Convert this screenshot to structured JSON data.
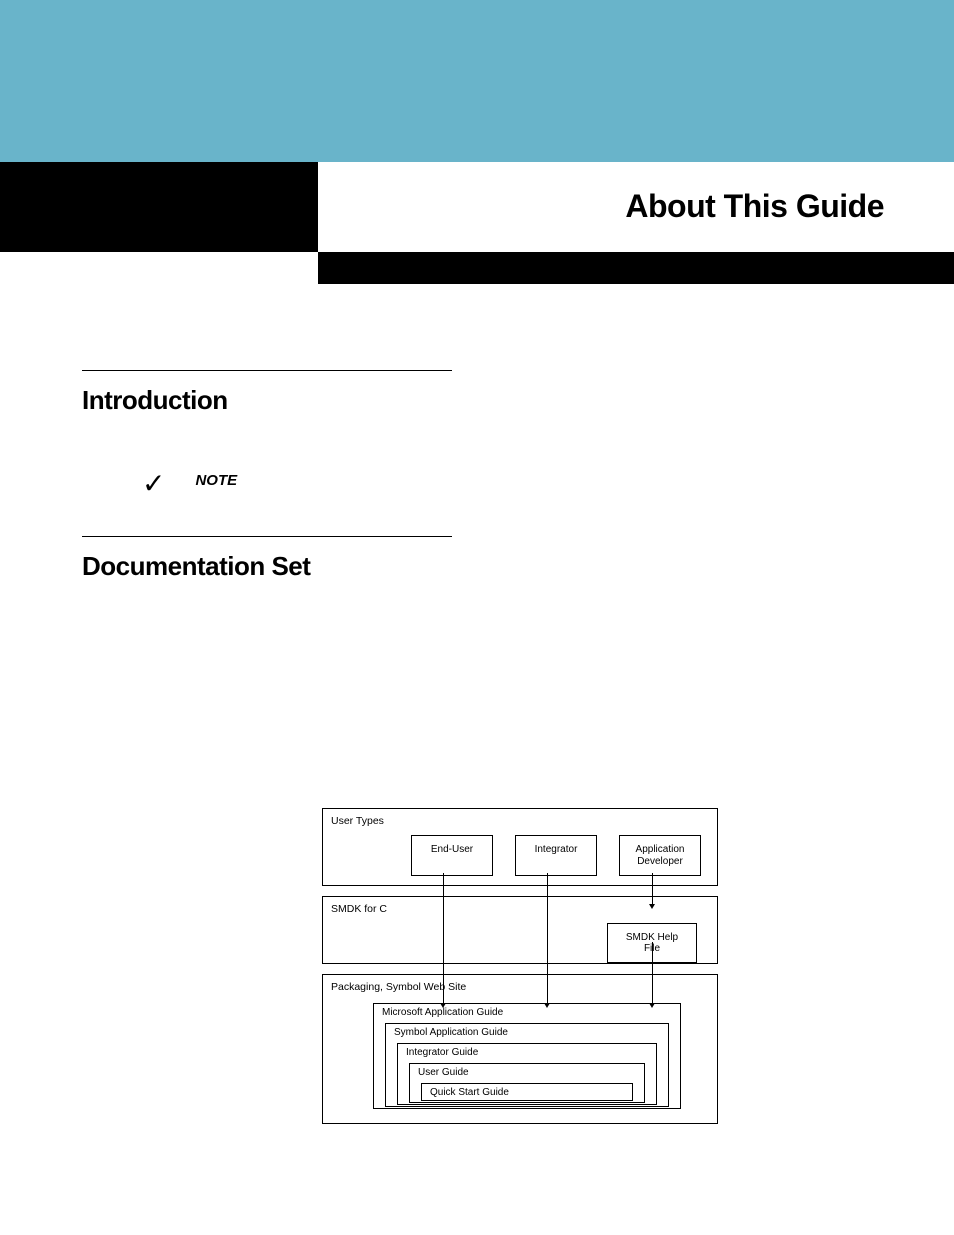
{
  "header": {
    "page_title": "About This Guide"
  },
  "sections": {
    "introduction": {
      "heading": "Introduction",
      "note_label": "NOTE"
    },
    "documentation_set": {
      "heading": "Documentation Set"
    }
  },
  "diagram": {
    "group1": {
      "label": "User Types",
      "boxes": [
        "End-User",
        "Integrator",
        "Application Developer"
      ]
    },
    "group2": {
      "label": "SMDK for  C",
      "box": "SMDK Help File"
    },
    "group3": {
      "label": "Packaging, Symbol Web Site",
      "stack": [
        "Microsoft Application Guide",
        "Symbol Application Guide",
        "Integrator Guide",
        "User Guide",
        "Quick Start Guide"
      ]
    }
  }
}
